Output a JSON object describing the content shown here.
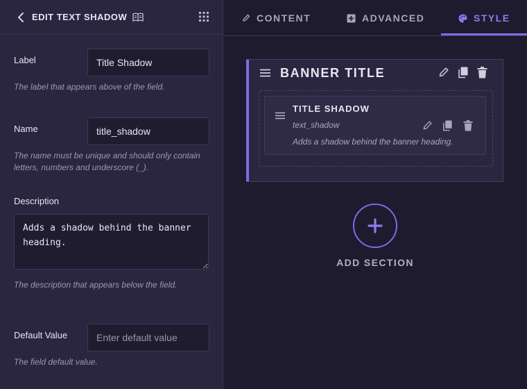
{
  "left_panel": {
    "header": {
      "title": "EDIT TEXT SHADOW",
      "back_icon": "chevron-left-icon",
      "docs_icon": "book-icon",
      "menu_icon": "grid-icon"
    },
    "label_field": {
      "label": "Label",
      "value": "Title Shadow",
      "help": "The label that appears above of the field."
    },
    "name_field": {
      "label": "Name",
      "value": "title_shadow",
      "help": "The name must be unique and should only contain letters, numbers and underscore (_)."
    },
    "description_field": {
      "label": "Description",
      "value": "Adds a shadow behind the banner heading.",
      "help": "The description that appears below the field."
    },
    "default_field": {
      "label": "Default Value",
      "value": "",
      "placeholder": "Enter default value",
      "help": "The field default value."
    }
  },
  "tabs": [
    {
      "label": "CONTENT",
      "icon": "pencil-icon",
      "active": false
    },
    {
      "label": "ADVANCED",
      "icon": "plus-box-icon",
      "active": false
    },
    {
      "label": "STYLE",
      "icon": "palette-icon",
      "active": true
    }
  ],
  "section": {
    "title": "BANNER TITLE",
    "actions": [
      "edit-icon",
      "copy-icon",
      "trash-icon"
    ],
    "field": {
      "title": "TITLE SHADOW",
      "name": "text_shadow",
      "description": "Adds a shadow behind the banner heading."
    }
  },
  "add_section": {
    "label": "ADD SECTION"
  },
  "colors": {
    "accent": "#7b6ce6",
    "panel": "#2a2640",
    "background": "#1e1b2e",
    "text": "#e8e6f2",
    "muted": "#9b98b0"
  }
}
